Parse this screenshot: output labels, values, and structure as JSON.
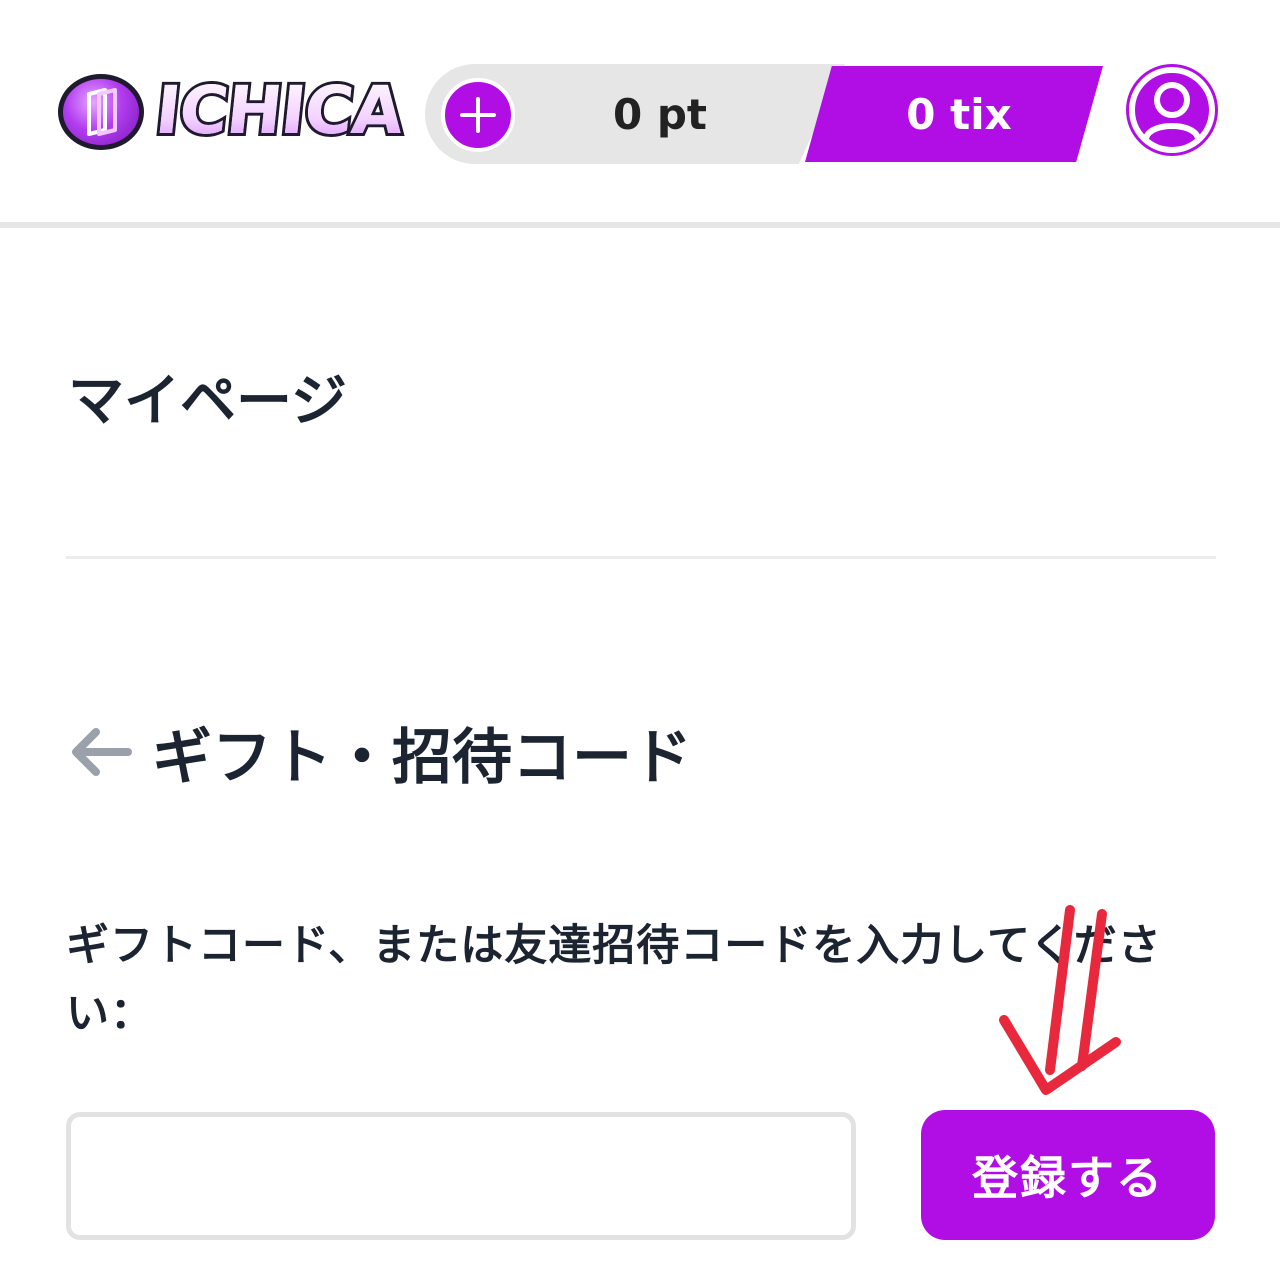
{
  "header": {
    "logo_text": "ICHICA",
    "points": "0 pt",
    "tickets": "0 tix",
    "add_icon": "plus-icon",
    "avatar_icon": "user-icon"
  },
  "page": {
    "title": "マイページ"
  },
  "section": {
    "back_icon": "arrow-left-icon",
    "title": "ギフト・招待コード",
    "instructions": "ギフトコード、または友達招待コードを入力してください：",
    "input": {
      "value": "",
      "placeholder": ""
    },
    "submit_label": "登録する"
  },
  "colors": {
    "accent": "#b10ee6",
    "annotation": "#e8283c"
  }
}
